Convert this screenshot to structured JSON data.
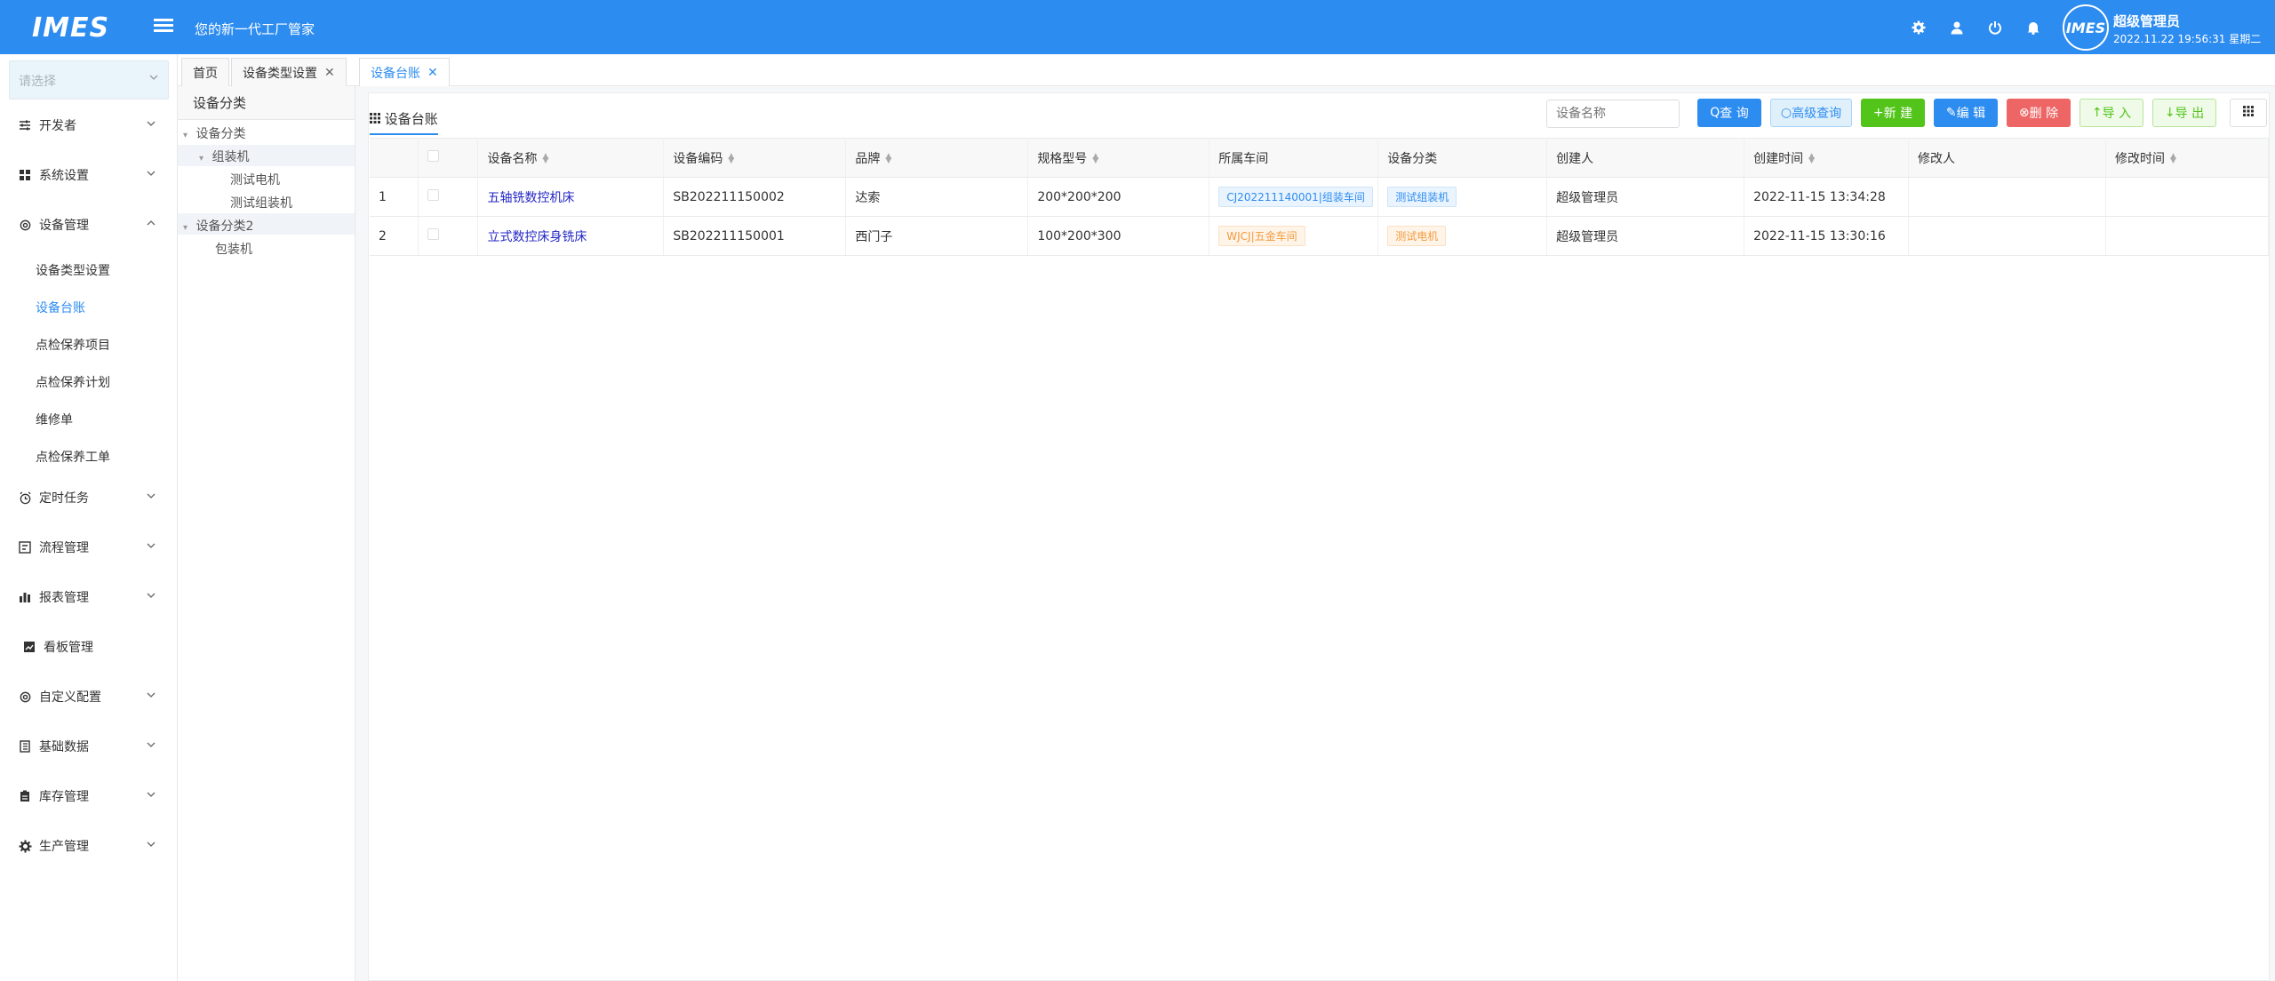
{
  "header": {
    "logo": "IMES",
    "slogan": "您的新一代工厂管家",
    "avatar_text": "IMES",
    "user_name": "超级管理员",
    "datetime": "2022.11.22 19:56:31 星期二"
  },
  "sidebar": {
    "select_placeholder": "请选择",
    "items": [
      {
        "label": "开发者",
        "icon": "sliders-icon"
      },
      {
        "label": "系统设置",
        "icon": "grid-icon"
      },
      {
        "label": "设备管理",
        "icon": "gear-outline-icon"
      },
      {
        "label": "定时任务",
        "icon": "alarm-icon"
      },
      {
        "label": "流程管理",
        "icon": "flow-icon"
      },
      {
        "label": "报表管理",
        "icon": "bar-chart-icon"
      },
      {
        "label": "看板管理",
        "icon": "dashboard-icon"
      },
      {
        "label": "自定义配置",
        "icon": "settings-icon"
      },
      {
        "label": "基础数据",
        "icon": "book-icon"
      },
      {
        "label": "库存管理",
        "icon": "clipboard-icon"
      },
      {
        "label": "生产管理",
        "icon": "cog-icon"
      }
    ],
    "sub_items": [
      "设备类型设置",
      "设备台账",
      "点检保养项目",
      "点检保养计划",
      "维修单",
      "点检保养工单"
    ]
  },
  "tabs": [
    {
      "label": "首页"
    },
    {
      "label": "设备类型设置"
    },
    {
      "label": "设备台账"
    }
  ],
  "tree": {
    "header": "设备分类",
    "nodes": [
      "设备分类",
      "组装机",
      "测试电机",
      "测试组装机",
      "设备分类2",
      "包装机"
    ]
  },
  "panel": {
    "title": "设备台账",
    "search_placeholder": "设备名称",
    "buttons": {
      "query": "查 询",
      "advanced": "高级查询",
      "new": "新 建",
      "edit": "编 辑",
      "delete": "删 除",
      "import": "导 入",
      "export": "导 出"
    }
  },
  "table": {
    "headers": [
      "设备名称",
      "设备编码",
      "品牌",
      "规格型号",
      "所属车间",
      "设备分类",
      "创建人",
      "创建时间",
      "修改人",
      "修改时间"
    ],
    "rows": [
      {
        "index": "1",
        "name": "五轴铣数控机床",
        "code": "SB202211150002",
        "brand": "达索",
        "spec": "200*200*200",
        "workshop": "CJ202211140001|组装车间",
        "category": "测试组装机",
        "creator": "超级管理员",
        "created": "2022-11-15 13:34:28",
        "modifier": "",
        "modified": ""
      },
      {
        "index": "2",
        "name": "立式数控床身铣床",
        "code": "SB202211150001",
        "brand": "西门子",
        "spec": "100*200*300",
        "workshop": "WJCJ|五金车间",
        "category": "测试电机",
        "creator": "超级管理员",
        "created": "2022-11-15 13:30:16",
        "modifier": "",
        "modified": ""
      }
    ]
  },
  "colors": {
    "primary": "#2d8cf0",
    "success": "#52c41a",
    "danger": "#ed6565",
    "link": "#2326c4"
  }
}
